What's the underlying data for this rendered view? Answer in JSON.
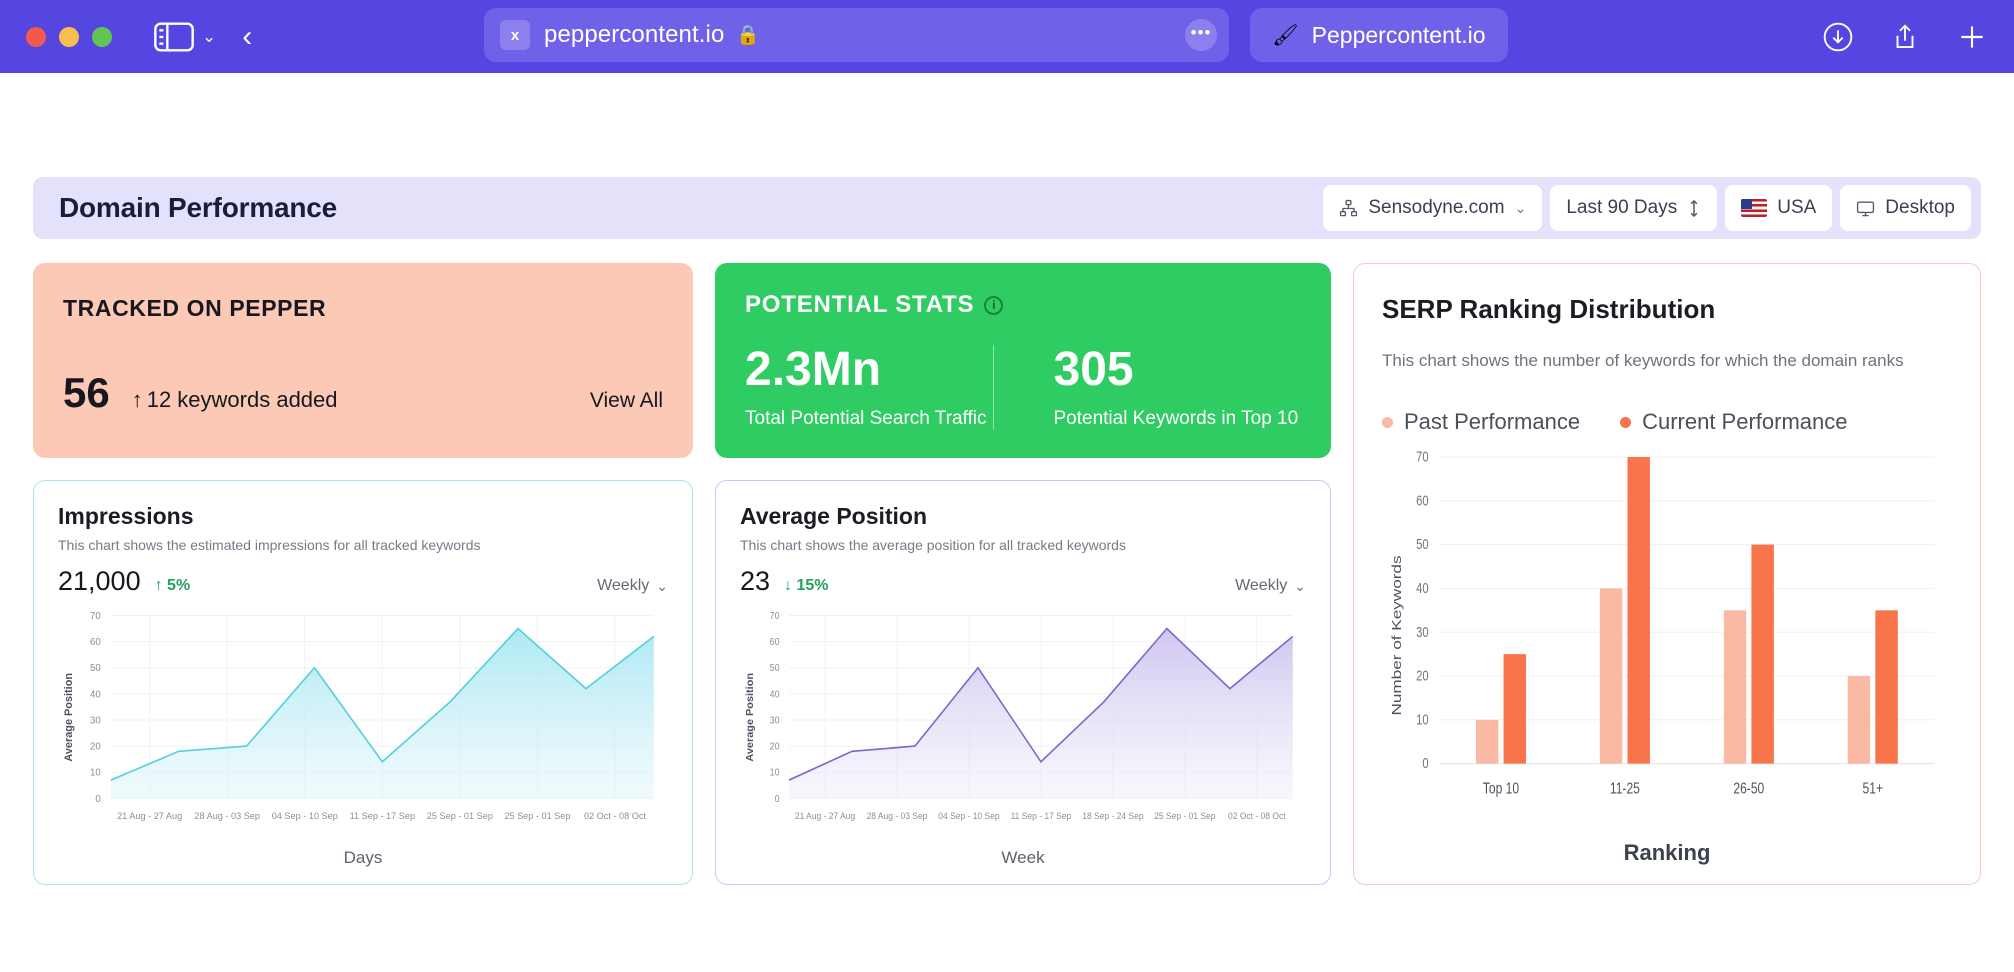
{
  "browser": {
    "url": "peppercontent.io",
    "extension_badge": "x",
    "lock_icon": "lock-icon",
    "more_icon": "more-dots-icon",
    "tab_label": "Peppercontent.io",
    "tab_favicon": "pepper-brush-icon",
    "sidebar_icon": "sidebar-toggle-icon",
    "tab_overview_icon": "chevron-down-icon",
    "back_icon": "back-arrow-icon",
    "download_icon": "download-icon",
    "share_icon": "share-icon",
    "new_tab_icon": "plus-icon"
  },
  "header": {
    "title": "Domain Performance",
    "filters": {
      "domain": {
        "label": "Sensodyne.com",
        "icon": "sitemap-icon",
        "caret": "chevron-down-icon"
      },
      "date_range": {
        "label": "Last 90 Days",
        "icon": "sort-updown-icon"
      },
      "country": {
        "label": "USA",
        "icon": "usa-flag-icon"
      },
      "device": {
        "label": "Desktop",
        "icon": "monitor-icon"
      }
    }
  },
  "tracked_card": {
    "title": "TRACKED ON PEPPER",
    "count": "56",
    "delta_arrow": "↑",
    "delta_label": "12 keywords added",
    "view_all": "View All",
    "bg_color": "#fbc9b6"
  },
  "potential_card": {
    "title": "POTENTIAL STATS",
    "info_icon": "info-icon",
    "bg_color": "#2ecc63",
    "stats": [
      {
        "value": "2.3Mn",
        "label": "Total Potential Search Traffic"
      },
      {
        "value": "305",
        "label": "Potential Keywords in Top 10"
      }
    ]
  },
  "serp_card": {
    "title": "SERP Ranking Distribution",
    "subtitle": "This chart shows the number of keywords for which the domain ranks",
    "legend": [
      {
        "label": "Past Performance",
        "color": "#f9b9a2"
      },
      {
        "label": "Current Performance",
        "color": "#f8744b"
      }
    ],
    "border_color": "#f6cdbb"
  },
  "impressions_card": {
    "title": "Impressions",
    "subtitle": "This chart shows the estimated impressions for all tracked keywords",
    "value": "21,000",
    "delta_arrow": "↑",
    "delta": "5%",
    "frequency": "Weekly",
    "frequency_caret": "chevron-down-icon",
    "border_color": "#a9e4ec"
  },
  "position_card": {
    "title": "Average Position",
    "subtitle": "This chart shows the average position for all tracked keywords",
    "value": "23",
    "delta_arrow": "↓",
    "delta": "15%",
    "frequency": "Weekly",
    "frequency_caret": "chevron-down-icon",
    "border_color": "#cfc6f2"
  },
  "chart_data": [
    {
      "type": "area",
      "id": "impressions",
      "title": "Impressions",
      "xlabel": "Days",
      "ylabel": "Average Position",
      "ylim": [
        0,
        70
      ],
      "yticks": [
        0,
        10,
        20,
        30,
        40,
        50,
        60,
        70
      ],
      "grid": true,
      "line_color": "#58cfdd",
      "fill_color": "#bfeef6",
      "categories": [
        "21 Aug - 27 Aug",
        "28 Aug - 03 Sep",
        "04 Sep - 10 Sep",
        "11 Sep - 17 Sep",
        "25 Sep - 01 Sep",
        "25 Sep - 01 Sep",
        "02 Oct - 08 Oct"
      ],
      "values": [
        7,
        18,
        20,
        50,
        14,
        37,
        65,
        42,
        62
      ]
    },
    {
      "type": "area",
      "id": "average-position",
      "title": "Average Position",
      "xlabel": "Week",
      "ylabel": "Average Position",
      "ylim": [
        0,
        70
      ],
      "yticks": [
        0,
        10,
        20,
        30,
        40,
        50,
        60,
        70
      ],
      "grid": true,
      "line_color": "#7b68c8",
      "fill_color": "#ddd6f3",
      "categories": [
        "21 Aug - 27 Aug",
        "28 Aug - 03 Sep",
        "04 Sep - 10 Sep",
        "11 Sep - 17 Sep",
        "18 Sep - 24 Sep",
        "25 Sep - 01 Sep",
        "02 Oct - 08 Oct"
      ],
      "values": [
        7,
        18,
        20,
        50,
        14,
        37,
        65,
        42,
        62
      ]
    },
    {
      "type": "bar",
      "id": "serp-ranking",
      "title": "SERP Ranking Distribution",
      "xlabel": "Ranking",
      "ylabel": "Number of Keywords",
      "ylim": [
        0,
        70
      ],
      "yticks": [
        0,
        10,
        20,
        30,
        40,
        50,
        60,
        70
      ],
      "grid": true,
      "categories": [
        "Top 10",
        "11-25",
        "26-50",
        "51+"
      ],
      "series": [
        {
          "name": "Past Performance",
          "color": "#f9b9a2",
          "values": [
            10,
            40,
            35,
            20
          ]
        },
        {
          "name": "Current Performance",
          "color": "#f8744b",
          "values": [
            25,
            70,
            50,
            35
          ]
        }
      ]
    }
  ]
}
